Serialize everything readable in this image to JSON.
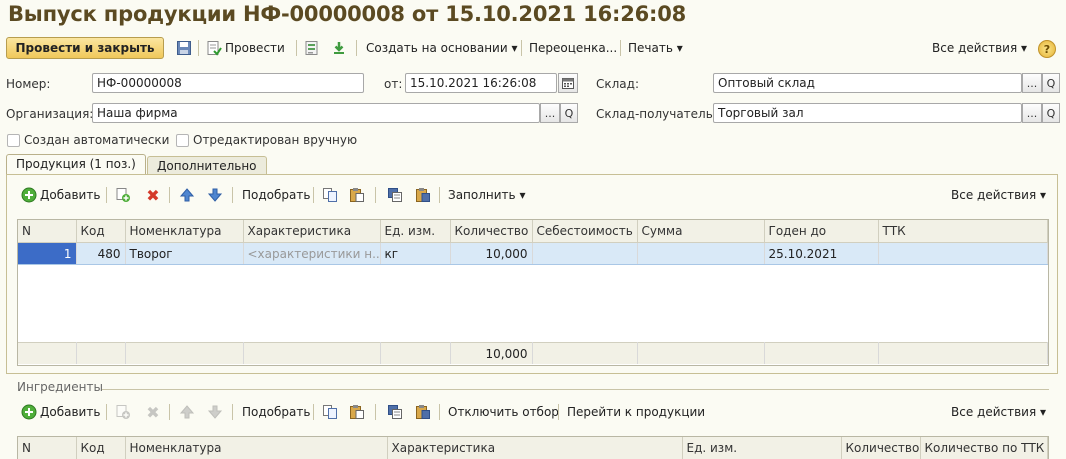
{
  "window": {
    "title": "Выпуск продукции НФ-00000008 от 15.10.2021 16:26:08"
  },
  "toolbar": {
    "post_close": "Провести и закрыть",
    "post": "Провести",
    "create_based": "Создать на основании",
    "revalue": "Переоценка...",
    "print": "Печать",
    "all_actions": "Все действия",
    "help": "?"
  },
  "form": {
    "number_label": "Номер:",
    "number_value": "НФ-00000008",
    "date_label": "от:",
    "date_value": "15.10.2021 16:26:08",
    "warehouse_label": "Склад:",
    "warehouse_value": "Оптовый склад",
    "org_label": "Организация:",
    "org_value": "Наша фирма",
    "recv_warehouse_label": "Склад-получатель:",
    "recv_warehouse_value": "Торговый зал",
    "auto_created": "Создан автоматически",
    "edited_manually": "Отредактирован вручную",
    "ellipsis": "...",
    "search_glyph": "Q"
  },
  "tabs": [
    {
      "label": "Продукция (1 поз.)"
    },
    {
      "label": "Дополнительно"
    }
  ],
  "products": {
    "toolbar": {
      "add": "Добавить",
      "pick": "Подобрать",
      "fill": "Заполнить",
      "all_actions": "Все действия"
    },
    "columns": [
      "N",
      "Код",
      "Номенклатура",
      "Характеристика",
      "Ед. изм.",
      "Количество",
      "Себестоимость",
      "Сумма",
      "Годен до",
      "ТТК"
    ],
    "rows": [
      {
        "n": "1",
        "code": "480",
        "item": "Творог",
        "char": "<характеристики н...",
        "unit": "кг",
        "qty": "10,000",
        "cost": "",
        "sum": "",
        "expiry": "25.10.2021",
        "ttk": ""
      }
    ],
    "total_qty": "10,000"
  },
  "ingredients": {
    "title": "Ингредиенты",
    "toolbar": {
      "add": "Добавить",
      "pick": "Подобрать",
      "disable_filter": "Отключить отбор",
      "go_products": "Перейти к продукции",
      "all_actions": "Все действия"
    },
    "columns": [
      "N",
      "Код",
      "Номенклатура",
      "Характеристика",
      "Ед. изм.",
      "Количество",
      "Количество по ТТК"
    ]
  },
  "colors": {
    "title": "#5b4a22",
    "accent_button": "#f0c85a",
    "selection": "#d9e9f7",
    "selected_num": "#3c6cc7"
  }
}
